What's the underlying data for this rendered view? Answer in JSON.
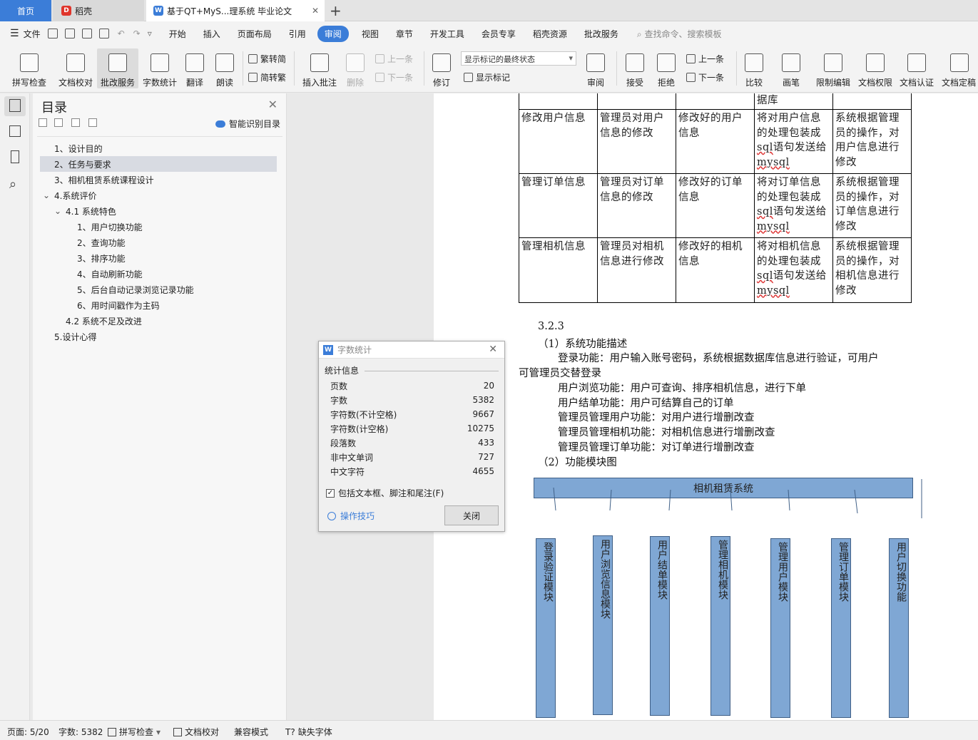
{
  "tabs": {
    "home": "首页",
    "daoke": "稻壳",
    "doc": "基于QT+MyS...理系统 毕业论文"
  },
  "menu": {
    "file": "文件",
    "items": [
      "开始",
      "插入",
      "页面布局",
      "引用",
      "审阅",
      "视图",
      "章节",
      "开发工具",
      "会员专享",
      "稻壳资源",
      "批改服务"
    ],
    "active": "审阅",
    "search": "查找命令、搜索模板"
  },
  "ribbon": {
    "spell": "拼写检查",
    "proof": "文档校对",
    "correct": "批改服务",
    "wordcount": "字数统计",
    "translate": "翻译",
    "read": "朗读",
    "trad": "繁转简",
    "simp": "简转繁",
    "insert_comment": "插入批注",
    "delete": "删除",
    "prev1": "上一条",
    "next1": "下一条",
    "revise": "修订",
    "markup_select": "显示标记的最终状态",
    "show_markup": "显示标记",
    "review": "审阅",
    "accept": "接受",
    "reject": "拒绝",
    "prev2": "上一条",
    "next2": "下一条",
    "compare": "比较",
    "pen": "画笔",
    "restrict": "限制编辑",
    "perm": "文档权限",
    "auth": "文档认证",
    "final": "文档定稿"
  },
  "toc": {
    "title": "目录",
    "smart": "智能识别目录",
    "items": [
      "1、设计目的",
      "2、任务与要求",
      "3、相机租赁系统课程设计",
      "4.系统评价",
      "4.1 系统特色",
      "1、用户切换功能",
      "2、查询功能",
      "3、排序功能",
      "4、自动刷新功能",
      "5、后台自动记录浏览记录功能",
      "6、用时间戳作为主码",
      "4.2 系统不足及改进",
      "5.设计心得"
    ]
  },
  "doc": {
    "partial": "据库",
    "rows": [
      [
        "修改用户信息",
        "管理员对用户信息的修改",
        "修改好的用户信息",
        "将对用户信息的处理包装成",
        "sql",
        "语句发送给",
        "mysql",
        "系统根据管理员的操作，对用户信息进行修改"
      ],
      [
        "管理订单信息",
        "管理员对订单信息的修改",
        "修改好的订单信息",
        "将对订单信息的处理包装成",
        "sql",
        "语句发送给",
        "mysql",
        "系统根据管理员的操作，对订单信息进行修改"
      ],
      [
        "管理相机信息",
        "管理员对相机信息进行修改",
        "修改好的相机信息",
        "将对相机信息的处理包装成",
        "sql",
        "语句发送给",
        "mysql",
        "系统根据管理员的操作，对相机信息进行修改"
      ]
    ],
    "heading": "3.2.3",
    "sub1": "（1）系统功能描述",
    "p1a": "登录功能：用户输入账号密码，系统根据数据库信息进行验证，可用户",
    "p1b": "可管理员交替登录",
    "p2": "用户浏览功能：用户可查询、排序相机信息，进行下单",
    "p3": "用户结单功能：用户可结算自己的订单",
    "p4": "管理员管理用户功能：对用户进行增删改查",
    "p5": "管理员管理相机功能：对相机信息进行增删改查",
    "p6": "管理员管理订单功能：对订单进行增删改查",
    "sub2": "（2）功能模块图",
    "top_box": "相机租赁系统",
    "modules": [
      "登录验证模块",
      "用户浏览信息模块",
      "用户结单模块",
      "管理相机模块",
      "管理用户模块",
      "管理订单模块",
      "用户切换功能"
    ]
  },
  "dialog": {
    "title": "字数统计",
    "section": "统计信息",
    "rows": [
      [
        "页数",
        "20"
      ],
      [
        "字数",
        "5382"
      ],
      [
        "字符数(不计空格)",
        "9667"
      ],
      [
        "字符数(计空格)",
        "10275"
      ],
      [
        "段落数",
        "433"
      ],
      [
        "非中文单词",
        "727"
      ],
      [
        "中文字符",
        "4655"
      ]
    ],
    "checkbox": "包括文本框、脚注和尾注(F)",
    "tips": "操作技巧",
    "close": "关闭"
  },
  "status": {
    "page": "页面: 5/20",
    "words": "字数: 5382",
    "spell": "拼写检查",
    "proof": "文档校对",
    "compat": "兼容模式",
    "font": "缺失字体"
  },
  "colors": {
    "accent": "#3b7dd8",
    "module": "#7fa7d4"
  }
}
